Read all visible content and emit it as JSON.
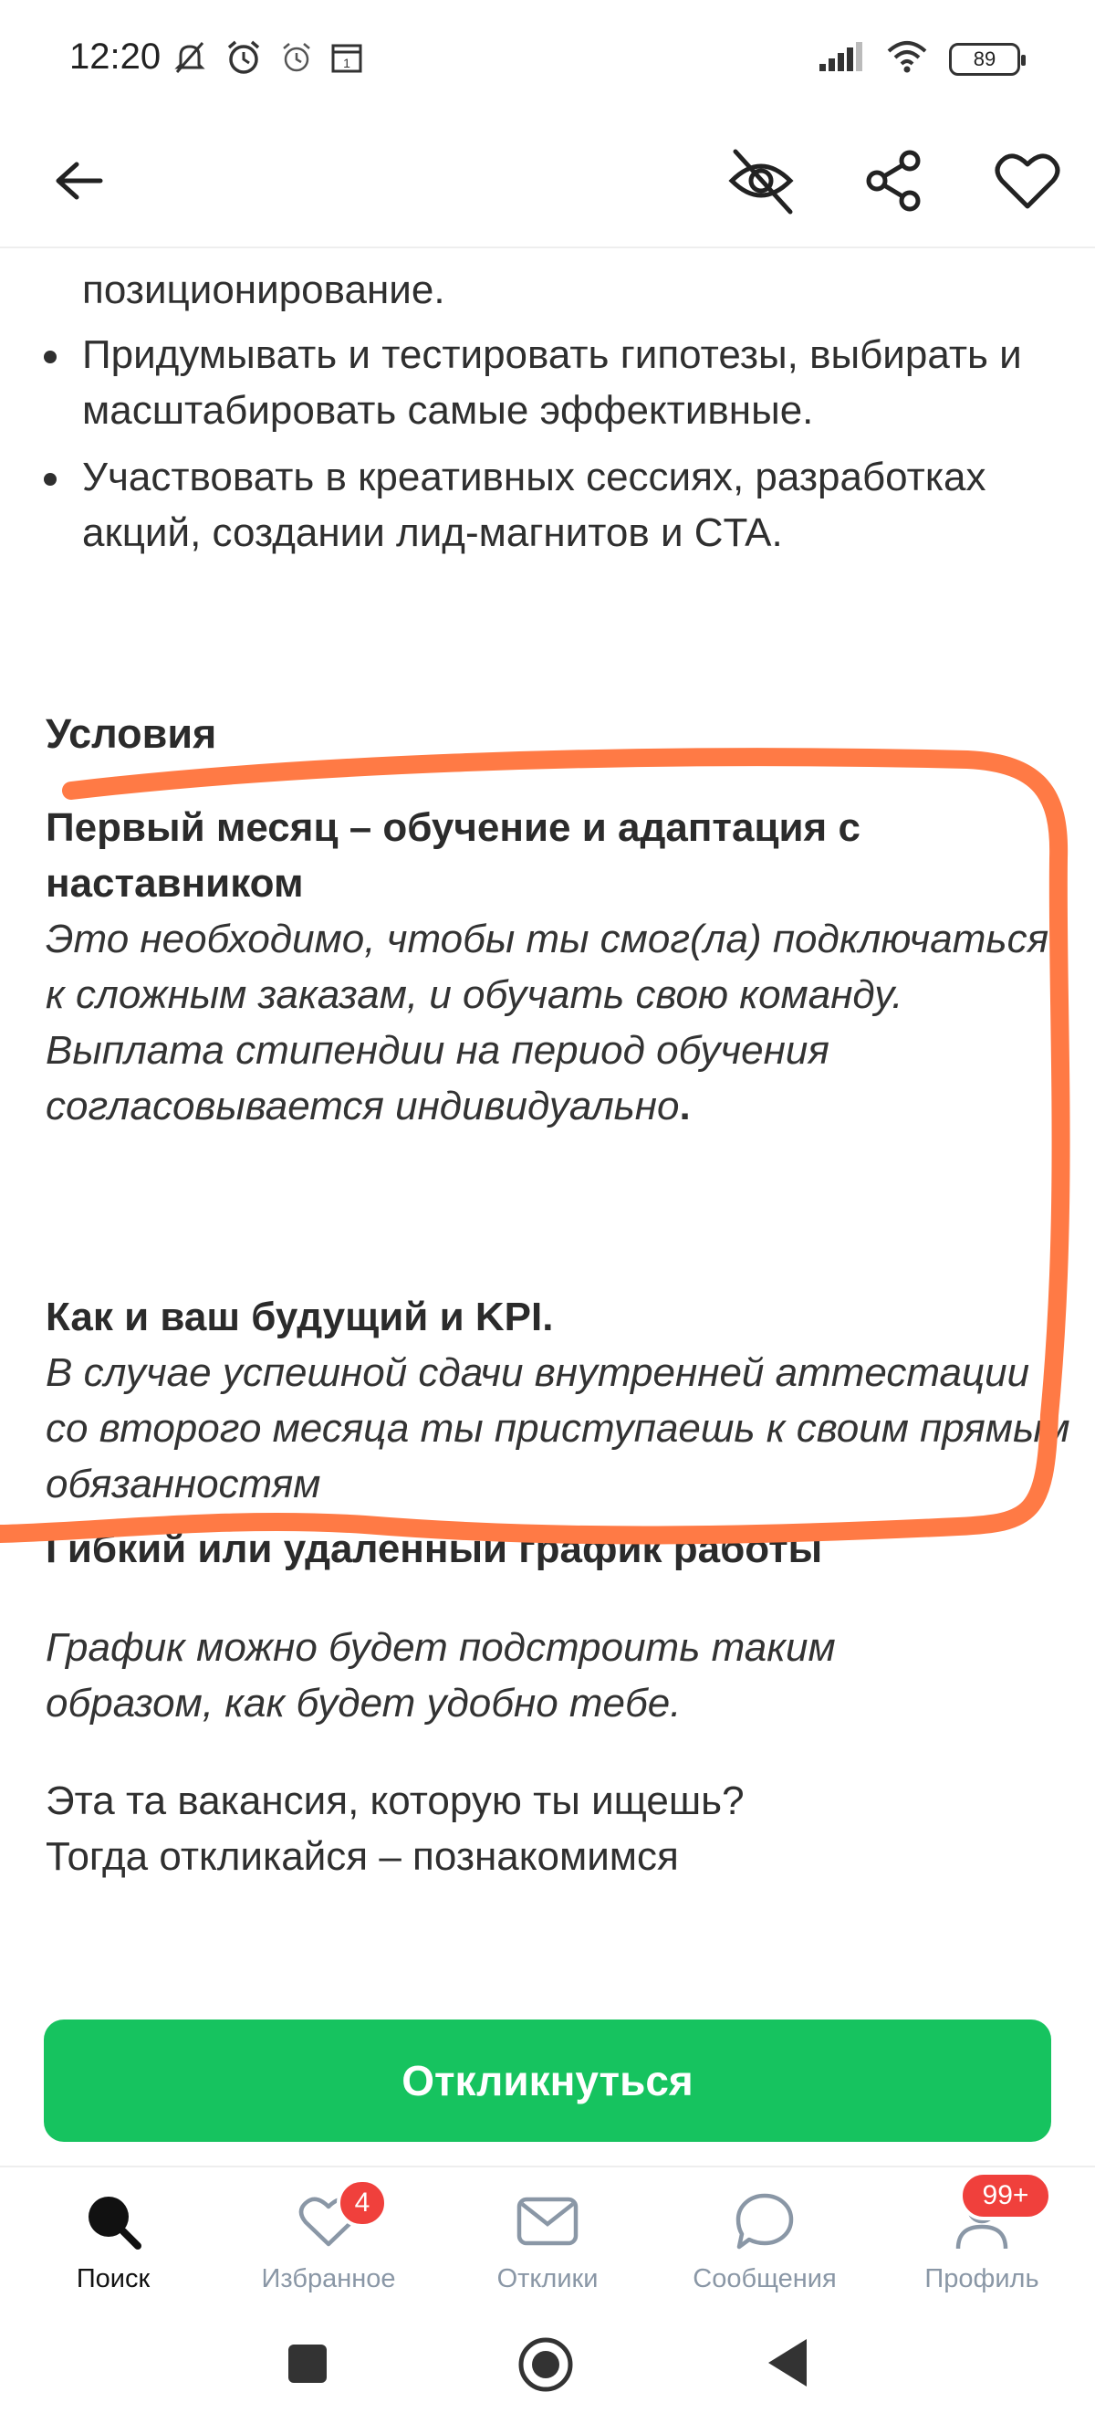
{
  "status_bar": {
    "time": "12:20",
    "battery": "89",
    "icons": [
      "mute-icon",
      "alarm-icon",
      "alarm-clock-icon",
      "calendar-icon",
      "signal-icon",
      "wifi-icon",
      "battery-icon"
    ]
  },
  "app_bar": {
    "icons": [
      "back-arrow-icon",
      "hide-eye-icon",
      "share-icon",
      "heart-icon"
    ]
  },
  "content": {
    "partial_top": "позиционирование.",
    "bullets": [
      "Придумывать и тестировать гипотезы, выбирать и масштабировать самые эффективные.",
      "Участвовать в креативных сессиях, разработках акций, создании лид-магнитов и CTA."
    ],
    "conditions_title": "Условия",
    "first_month_title": "Первый месяц – обучение и адаптация с наставником",
    "first_month_text": "Это необходимо, чтобы ты смог(ла) подключаться к сложным заказам, и обучать свою команду.\nВыплата стипендии на период обучения согласовывается индивидуально",
    "first_month_dot": ".",
    "kpi_title": "Как и ваш будущий и KPI.",
    "kpi_text": "В случае успешной сдачи внутренней аттестации со второго месяца ты приступаешь к своим прямым обязанностям",
    "schedule_title": "Гибкий или удаленный график работы",
    "schedule_text": "График можно будет подстроить таким образом, как будет удобно тебе.",
    "closing_text": "Эта та вакансия, которую ты ищешь?\nТогда откликайся – познакомимся"
  },
  "respond_button": "Откликнуться",
  "bottom_nav": {
    "items": [
      {
        "label": "Поиск",
        "icon": "search-icon",
        "active": true
      },
      {
        "label": "Избранное",
        "icon": "heart-icon",
        "badge": "4"
      },
      {
        "label": "Отклики",
        "icon": "envelope-icon"
      },
      {
        "label": "Сообщения",
        "icon": "chat-bubble-icon"
      },
      {
        "label": "Профиль",
        "icon": "person-icon",
        "badge": "99+"
      }
    ]
  },
  "colors": {
    "accent_green": "#16c35f",
    "annotation_orange": "#ff7a45",
    "badge_red": "#f0403c",
    "nav_inactive": "#8a97a6"
  }
}
